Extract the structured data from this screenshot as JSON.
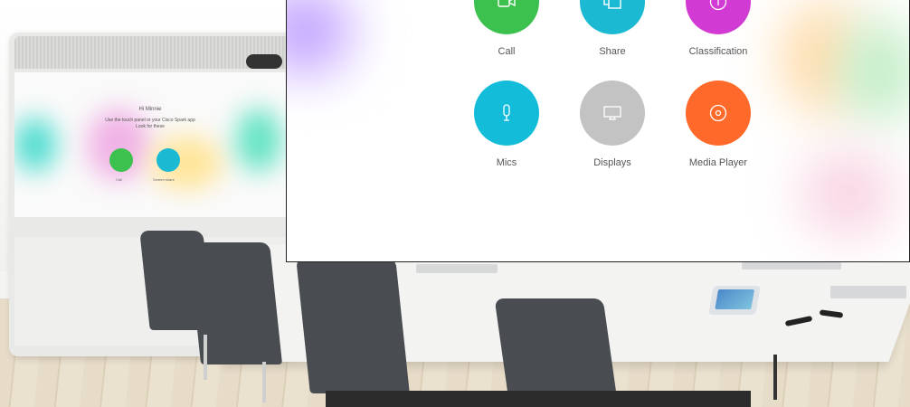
{
  "device_screen": {
    "heading": "Hi Minnie",
    "instructions": [
      "Use the touch panel or your Cisco Spark app",
      "Look for these"
    ],
    "actions": [
      {
        "label": "Call"
      },
      {
        "label": "Screen share"
      }
    ]
  },
  "home_menu": {
    "items": [
      {
        "label": "Call",
        "icon": "video-camera-icon",
        "color": "#3cc14e"
      },
      {
        "label": "Share",
        "icon": "share-screen-icon",
        "color": "#1cb9d2"
      },
      {
        "label": "Classification",
        "icon": "info-icon",
        "color": "#d23ad4"
      },
      {
        "label": "Mics",
        "icon": "microphone-icon",
        "color": "#13bcd8"
      },
      {
        "label": "Displays",
        "icon": "monitor-icon",
        "color": "#c3c3c3"
      },
      {
        "label": "Media Player",
        "icon": "disc-icon",
        "color": "#ff6a2b"
      }
    ]
  }
}
